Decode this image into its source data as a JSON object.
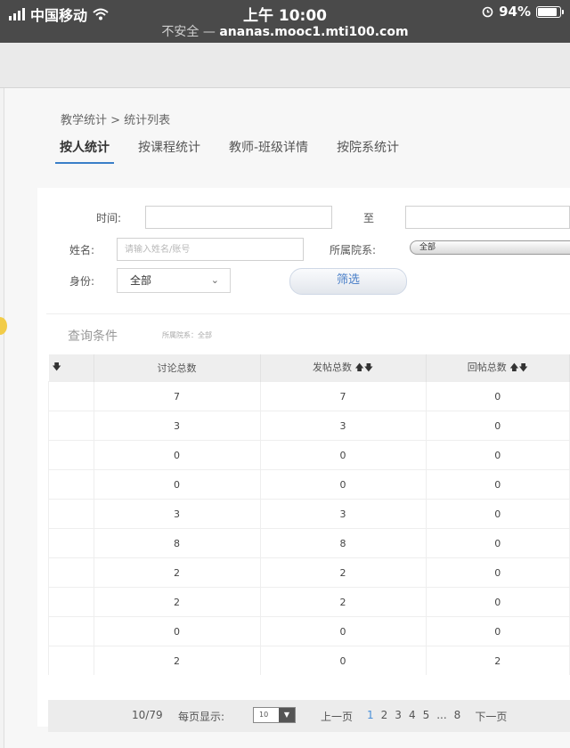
{
  "statusbar": {
    "carrier": "中国移动",
    "time": "上午 10:00",
    "battery": "94%",
    "battery_level": 0.94,
    "url_prefix": "不安全 — ",
    "url": "ananas.mooc1.mti100.com"
  },
  "breadcrumb": "教学统计 > 统计列表",
  "tabs": [
    {
      "label": "按人统计"
    },
    {
      "label": "按课程统计"
    },
    {
      "label": "教师-班级详情"
    },
    {
      "label": "按院系统计"
    }
  ],
  "filters": {
    "time_label": "时间:",
    "to_label": "至",
    "name_label": "姓名:",
    "name_placeholder": "请输入姓名/账号",
    "dept_label": "所属院系:",
    "dept_value": "全部",
    "role_label": "身份:",
    "role_value": "全部",
    "filter_button": "筛选"
  },
  "query": {
    "title": "查询条件",
    "condition": "所属院系：全部"
  },
  "table": {
    "headers": [
      "",
      "讨论总数",
      "发帖总数",
      "回帖总数"
    ],
    "rows": [
      [
        "",
        "7",
        "7",
        "0"
      ],
      [
        "",
        "3",
        "3",
        "0"
      ],
      [
        "",
        "0",
        "0",
        "0"
      ],
      [
        "",
        "0",
        "0",
        "0"
      ],
      [
        "",
        "3",
        "3",
        "0"
      ],
      [
        "",
        "8",
        "8",
        "0"
      ],
      [
        "",
        "2",
        "2",
        "0"
      ],
      [
        "",
        "2",
        "2",
        "0"
      ],
      [
        "",
        "0",
        "0",
        "0"
      ],
      [
        "",
        "2",
        "0",
        "2"
      ]
    ]
  },
  "pager": {
    "count": "10/79",
    "per_page_label": "每页显示:",
    "page_size": "10",
    "prev": "上一页",
    "pages": [
      "1",
      "2",
      "3",
      "4",
      "5",
      "...",
      "8"
    ],
    "current": "1",
    "next": "下一页"
  },
  "icons": {
    "sort_desc": "arrow-down-icon",
    "sort_both": "sort-up-down-icon"
  }
}
